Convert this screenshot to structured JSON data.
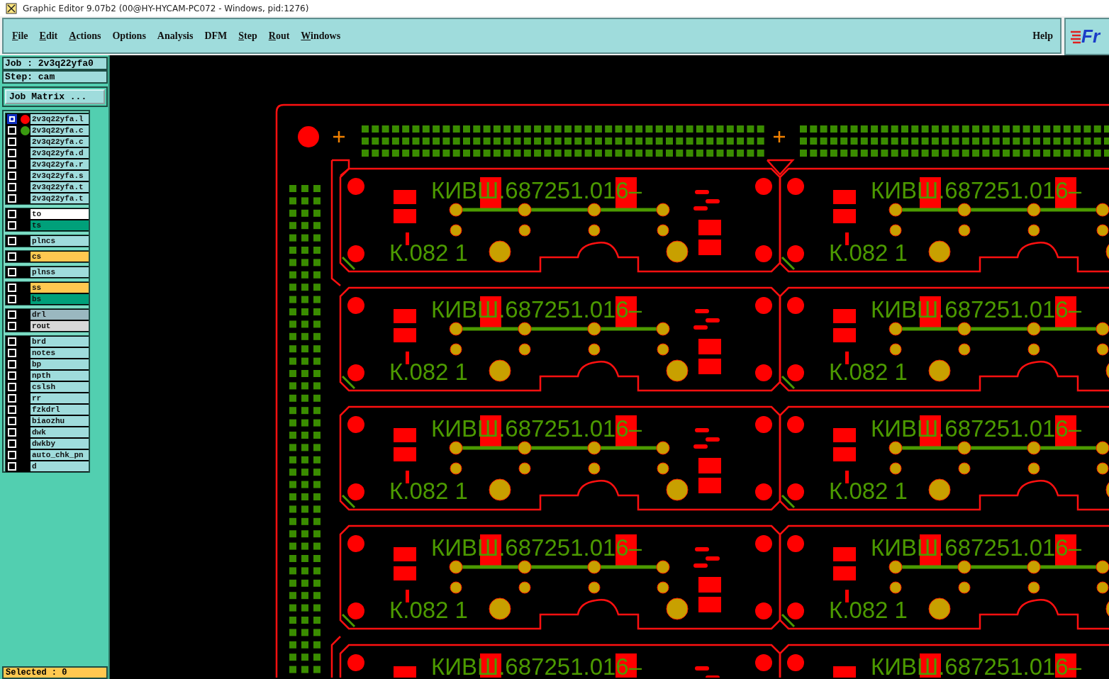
{
  "window": {
    "title": "Graphic Editor 9.07b2 (00@HY-HYCAM-PC072 - Windows, pid:1276)"
  },
  "menu": [
    {
      "label": "File",
      "mnemonic": true
    },
    {
      "label": "Edit",
      "mnemonic": true
    },
    {
      "label": "Actions",
      "mnemonic": true
    },
    {
      "label": "Options",
      "mnemonic": false
    },
    {
      "label": "Analysis",
      "mnemonic": false
    },
    {
      "label": "DFM",
      "mnemonic": false
    },
    {
      "label": "Step",
      "mnemonic": true
    },
    {
      "label": "Rout",
      "mnemonic": true
    },
    {
      "label": "Windows",
      "mnemonic": true
    }
  ],
  "help": "Help",
  "logo_text": "Fr",
  "job": "Job : 2v3q22yfa0",
  "step": "Step: cam",
  "job_matrix_button": "Job Matrix ...",
  "layer_groups": [
    {
      "layers": [
        {
          "name": "2v3q22yfa.l",
          "selected": true,
          "color": "#9fdcdc",
          "dot": {
            "color": "#ff0000"
          }
        },
        {
          "name": "2v3q22yfa.c",
          "selected": false,
          "color": "#9fdcdc",
          "dot": {
            "color": "#3a9a10"
          }
        },
        {
          "name": "2v3q22yfa.c",
          "selected": false,
          "color": "#9fdcdc"
        },
        {
          "name": "2v3q22yfa.d",
          "selected": false,
          "color": "#9fdcdc"
        },
        {
          "name": "2v3q22yfa.r",
          "selected": false,
          "color": "#9fdcdc"
        },
        {
          "name": "2v3q22yfa.s",
          "selected": false,
          "color": "#9fdcdc"
        },
        {
          "name": "2v3q22yfa.t",
          "selected": false,
          "color": "#9fdcdc"
        },
        {
          "name": "2v3q22yfa.t",
          "selected": false,
          "color": "#9fdcdc"
        }
      ]
    },
    {
      "layers": [
        {
          "name": "to",
          "selected": false,
          "color": "#ffffff"
        },
        {
          "name": "ts",
          "selected": false,
          "color": "#00a07a"
        }
      ]
    },
    {
      "layers": [
        {
          "name": "plncs",
          "selected": false,
          "color": "#9fdcdc"
        }
      ]
    },
    {
      "layers": [
        {
          "name": "cs",
          "selected": false,
          "color": "#ffc850"
        }
      ]
    },
    {
      "layers": [
        {
          "name": "plnss",
          "selected": false,
          "color": "#9fdcdc"
        }
      ]
    },
    {
      "layers": [
        {
          "name": "ss",
          "selected": false,
          "color": "#ffc850"
        },
        {
          "name": "bs",
          "selected": false,
          "color": "#00a07a"
        }
      ]
    },
    {
      "layers": [
        {
          "name": "drl",
          "selected": false,
          "color": "#9ab8c0"
        },
        {
          "name": "rout",
          "selected": false,
          "color": "#d8d8d8"
        }
      ]
    },
    {
      "layers": [
        {
          "name": "brd",
          "selected": false,
          "color": "#9fdcdc"
        },
        {
          "name": "notes",
          "selected": false,
          "color": "#9fdcdc"
        },
        {
          "name": "bp",
          "selected": false,
          "color": "#9fdcdc"
        },
        {
          "name": "npth",
          "selected": false,
          "color": "#9fdcdc"
        },
        {
          "name": "cslsh",
          "selected": false,
          "color": "#9fdcdc"
        },
        {
          "name": "rr",
          "selected": false,
          "color": "#9fdcdc"
        },
        {
          "name": "fzkdrl",
          "selected": false,
          "color": "#9fdcdc"
        },
        {
          "name": "biaozhu",
          "selected": false,
          "color": "#9fdcdc"
        },
        {
          "name": "dwk",
          "selected": false,
          "color": "#9fdcdc"
        },
        {
          "name": "dwkby",
          "selected": false,
          "color": "#9fdcdc"
        },
        {
          "name": "auto_chk_pn",
          "selected": false,
          "color": "#9fdcdc"
        },
        {
          "name": "d",
          "selected": false,
          "color": "#9fdcdc"
        }
      ]
    }
  ],
  "selected_count": "Selected : 0",
  "board": {
    "cells": [
      {
        "marking": "КИВШ.687251.016–",
        "code": "К.082 1"
      },
      {
        "marking": "КИВШ.687251.016–",
        "code": "К.082 1"
      },
      {
        "marking": "КИВШ.687251.016–",
        "code": "К.082 1"
      },
      {
        "marking": "КИВШ.687251.016–",
        "code": "К.082 1"
      },
      {
        "marking": "КИВШ.687251.016–",
        "code": "К.082 1"
      },
      {
        "marking": "КИВШ.687251.016–",
        "code": "К.082 1"
      },
      {
        "marking": "КИВШ.687251.016–",
        "code": "К.082 1"
      },
      {
        "marking": "КИВШ.687251.016–",
        "code": "К.082 1"
      },
      {
        "marking": "КИВШ.687251.016–"
      },
      {
        "marking": "КИВШ.687251.016–"
      }
    ]
  }
}
